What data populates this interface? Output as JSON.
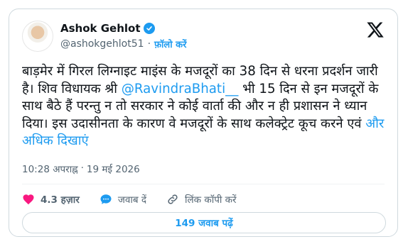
{
  "author": {
    "name": "Ashok Gehlot",
    "handle": "@ashokgehlot51",
    "separator": "·",
    "follow_label": "फ़ॉलो करें"
  },
  "tweet": {
    "text_before": "बाड़मेर में गिरल लिग्नाइट माइंस के मजदूरों का 38 दिन से धरना प्रदर्शन जारी है। शिव विधायक श्री ",
    "mention": "@RavindraBhati__",
    "text_after": " भी 15 दिन से इन मजदूरों के साथ बैठे हैं परन्तु न तो सरकार ने कोई वार्ता की और न ही प्रशासन ने ध्यान दिया। इस उदासीनता के कारण वे मजदूरों के साथ कलेक्ट्रेट कूच करने एवं ",
    "show_more": "और अधिक दिखाएं"
  },
  "meta": {
    "time": "10:28 अपराह्न",
    "separator": "·",
    "date": "19 मई 2026"
  },
  "actions": {
    "likes": "4.3 हज़ार",
    "reply_label": "जवाब दें",
    "copy_link_label": "लिंक कॉपी करें"
  },
  "replies_button": "149 जवाब पढ़ें",
  "colors": {
    "accent": "#1d9bf0",
    "like": "#f91880",
    "text": "#0f1419",
    "muted": "#536471"
  },
  "icons": [
    "verified-badge-icon",
    "x-logo-icon",
    "heart-icon",
    "reply-icon",
    "link-icon"
  ]
}
